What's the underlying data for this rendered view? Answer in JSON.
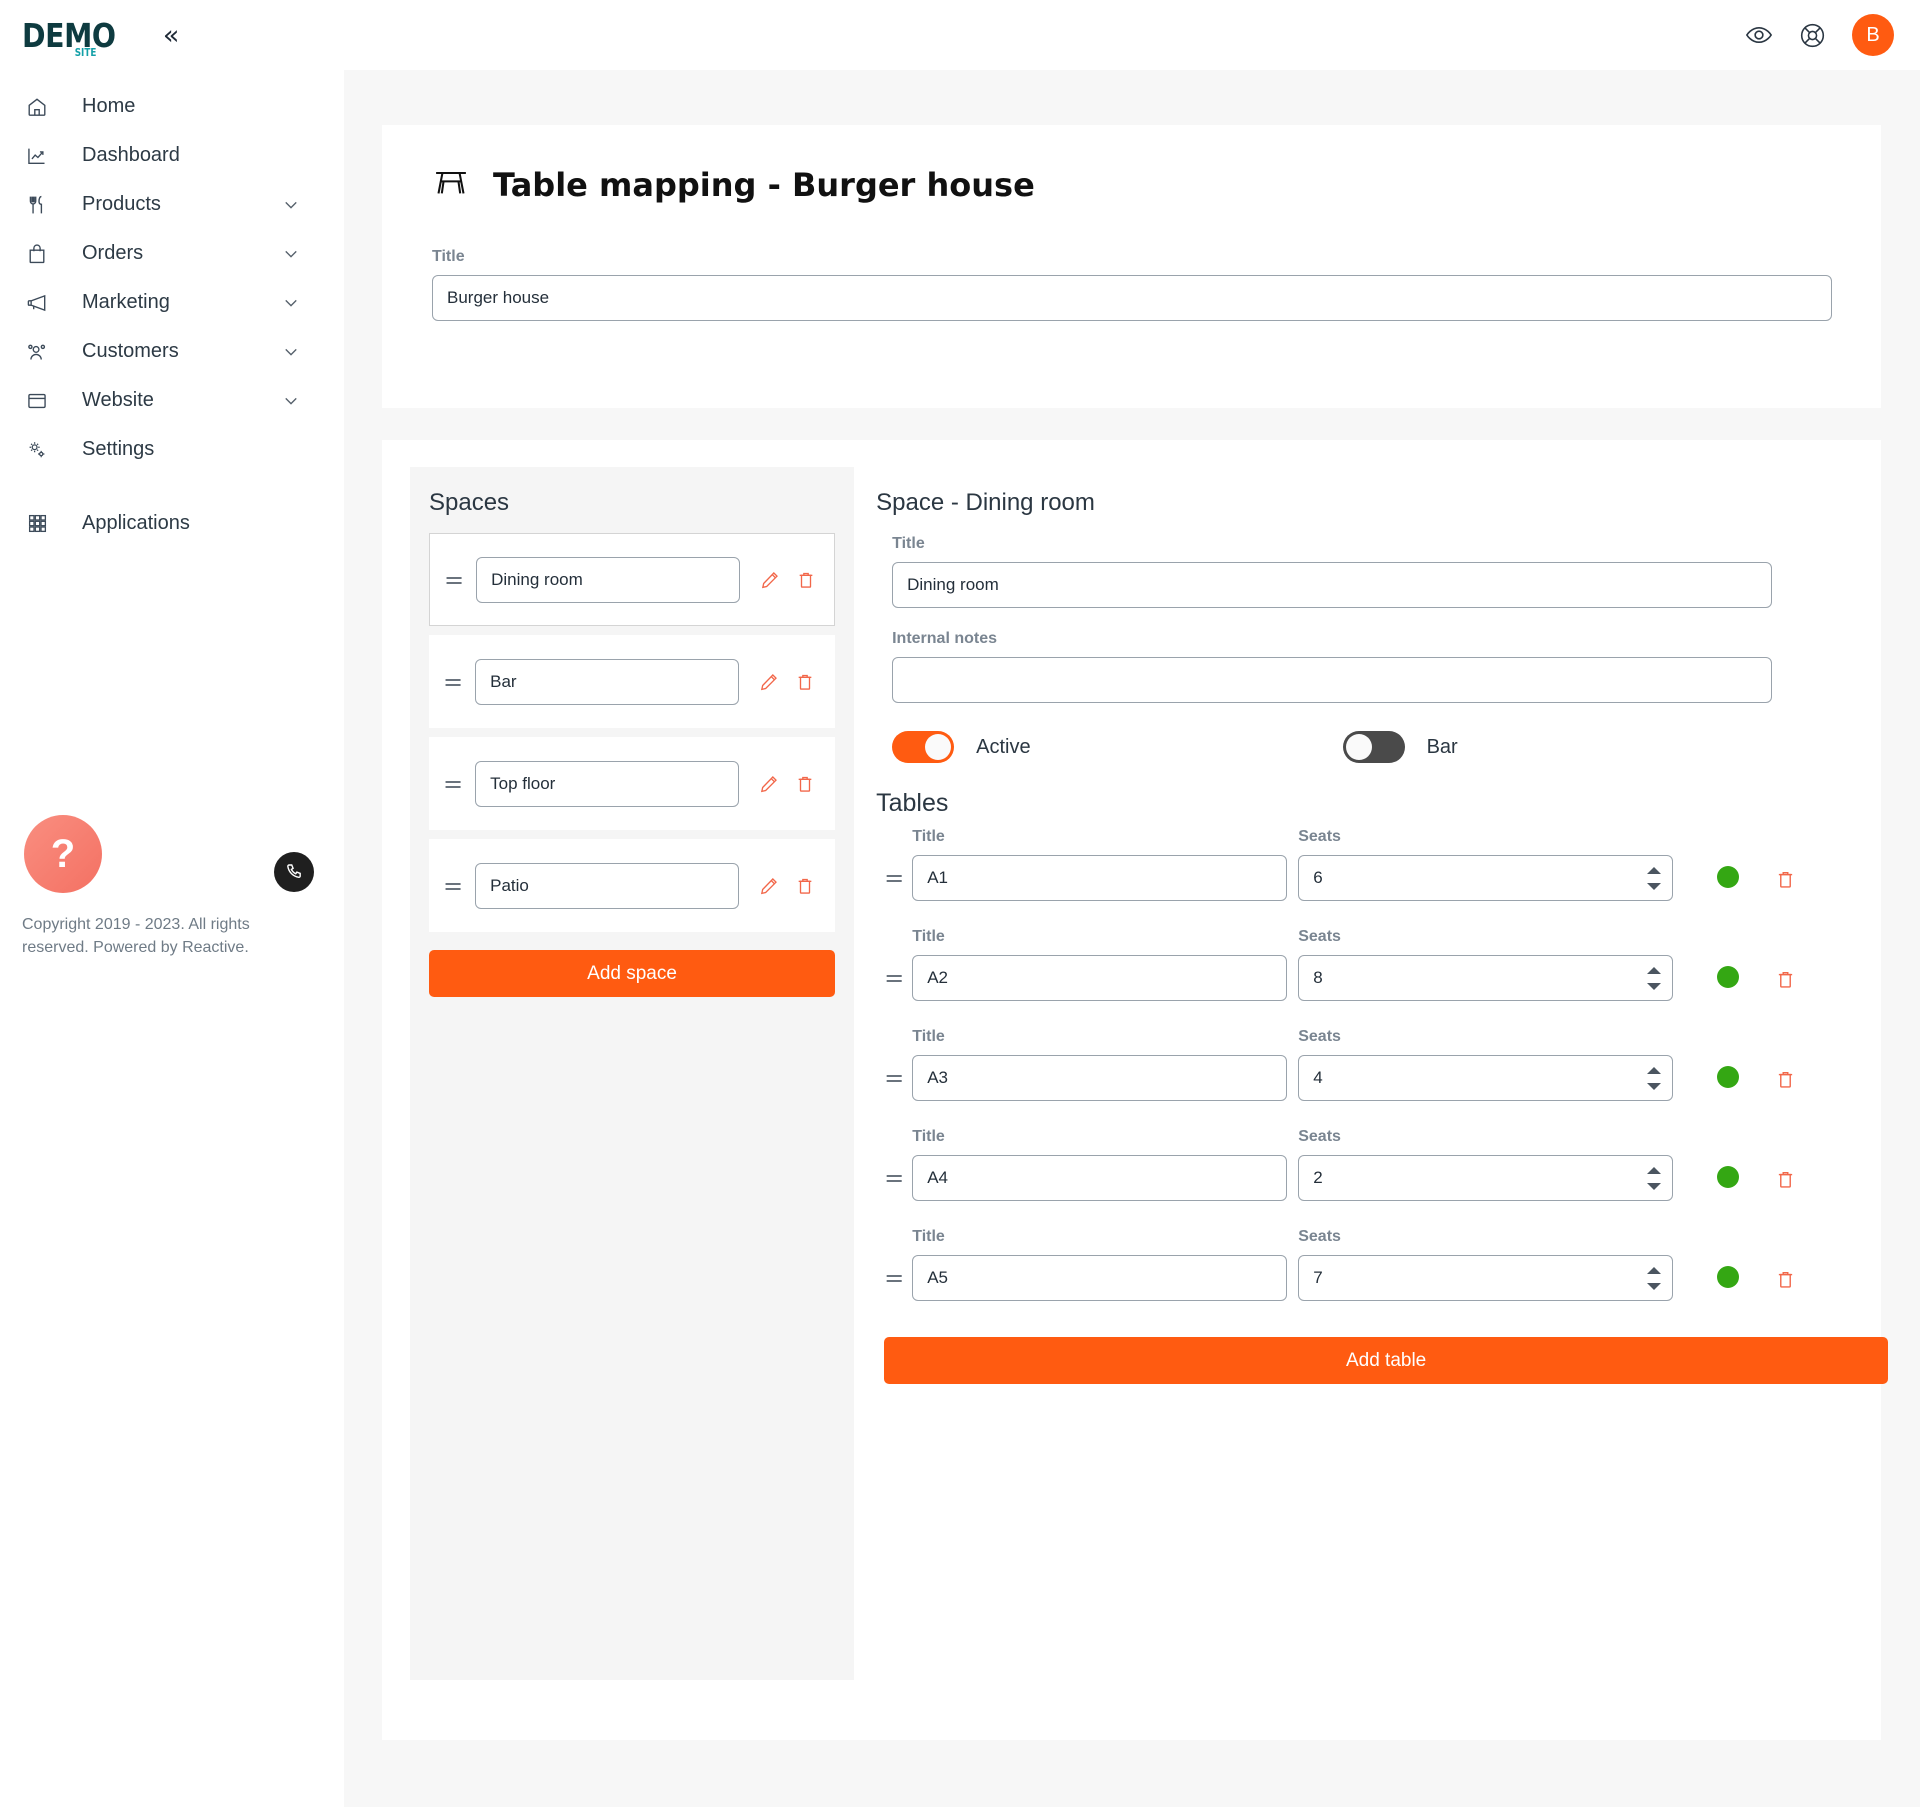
{
  "brand": {
    "logo_main": "DEMO",
    "logo_sub": "SITE"
  },
  "topbar": {
    "collapse_label": "«",
    "preview_icon": "eye-icon",
    "support_icon": "lifebuoy-icon",
    "avatar_initial": "B",
    "accent_color": "#FF5B11"
  },
  "sidebar": {
    "items": [
      {
        "label": "Home",
        "icon": "home-icon",
        "expandable": false
      },
      {
        "label": "Dashboard",
        "icon": "chart-line-icon",
        "expandable": false
      },
      {
        "label": "Products",
        "icon": "cutlery-icon",
        "expandable": true
      },
      {
        "label": "Orders",
        "icon": "bag-icon",
        "expandable": true
      },
      {
        "label": "Marketing",
        "icon": "megaphone-icon",
        "expandable": true
      },
      {
        "label": "Customers",
        "icon": "users-icon",
        "expandable": true
      },
      {
        "label": "Website",
        "icon": "browser-icon",
        "expandable": true
      },
      {
        "label": "Settings",
        "icon": "gears-icon",
        "expandable": false
      },
      {
        "label": "Applications",
        "icon": "grid-icon",
        "expandable": false
      }
    ],
    "footer_copy": "Copyright 2019 - 2023. All rights reserved. Powered by Reactive.",
    "help_label": "?",
    "phone_icon": "phone-icon"
  },
  "page": {
    "icon": "picnic-table-icon",
    "title": "Table mapping - Burger house",
    "title_field": {
      "label": "Title",
      "value": "Burger house"
    }
  },
  "spaces_panel": {
    "heading": "Spaces",
    "add_button": "Add space",
    "edit_icon": "pencil-icon",
    "delete_icon": "trash-icon",
    "drag_icon": "drag-handle-icon",
    "items": [
      {
        "name": "Dining room",
        "selected": true
      },
      {
        "name": "Bar",
        "selected": false
      },
      {
        "name": "Top floor",
        "selected": false
      },
      {
        "name": "Patio",
        "selected": false
      }
    ]
  },
  "space_detail": {
    "heading": "Space - Dining room",
    "title_field": {
      "label": "Title",
      "value": "Dining room"
    },
    "notes_field": {
      "label": "Internal notes",
      "value": ""
    },
    "toggles": [
      {
        "label": "Active",
        "state": "on"
      },
      {
        "label": "Bar",
        "state": "off"
      }
    ],
    "tables_heading": "Tables",
    "col_title_label": "Title",
    "col_seats_label": "Seats",
    "status_color": "#34a713",
    "add_button": "Add table",
    "tables": [
      {
        "title": "A1",
        "seats": "6",
        "active": true
      },
      {
        "title": "A2",
        "seats": "8",
        "active": true
      },
      {
        "title": "A3",
        "seats": "4",
        "active": true
      },
      {
        "title": "A4",
        "seats": "2",
        "active": true
      },
      {
        "title": "A5",
        "seats": "7",
        "active": true
      }
    ]
  }
}
